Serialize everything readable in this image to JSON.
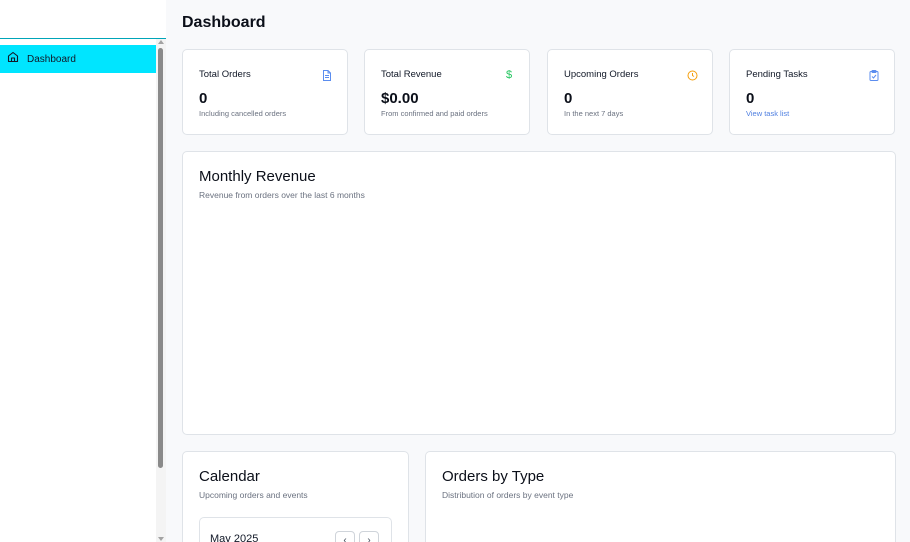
{
  "sidebar": {
    "items": [
      {
        "label": "Dashboard",
        "icon": "home-icon"
      }
    ]
  },
  "page": {
    "title": "Dashboard"
  },
  "stats": [
    {
      "title": "Total Orders",
      "value": "0",
      "sub": "Including cancelled orders",
      "icon": "document-icon",
      "color": "#5b8def"
    },
    {
      "title": "Total Revenue",
      "value": "$0.00",
      "sub": "From confirmed and paid orders",
      "icon": "dollar-icon",
      "color": "#22c55e"
    },
    {
      "title": "Upcoming Orders",
      "value": "0",
      "sub": "In the next 7 days",
      "icon": "clock-icon",
      "color": "#f59e0b"
    },
    {
      "title": "Pending Tasks",
      "value": "0",
      "sub": "View task list",
      "icon": "clipboard-icon",
      "color": "#5b8def"
    }
  ],
  "monthly_revenue": {
    "title": "Monthly Revenue",
    "subtitle": "Revenue from orders over the last 6 months"
  },
  "calendar": {
    "title": "Calendar",
    "subtitle": "Upcoming orders and events",
    "month": "May 2025",
    "prev": "‹",
    "next": "›"
  },
  "orders_by_type": {
    "title": "Orders by Type",
    "subtitle": "Distribution of orders by event type"
  },
  "colors": {
    "accent": "#00e5ff",
    "link": "#4f7fe0"
  }
}
